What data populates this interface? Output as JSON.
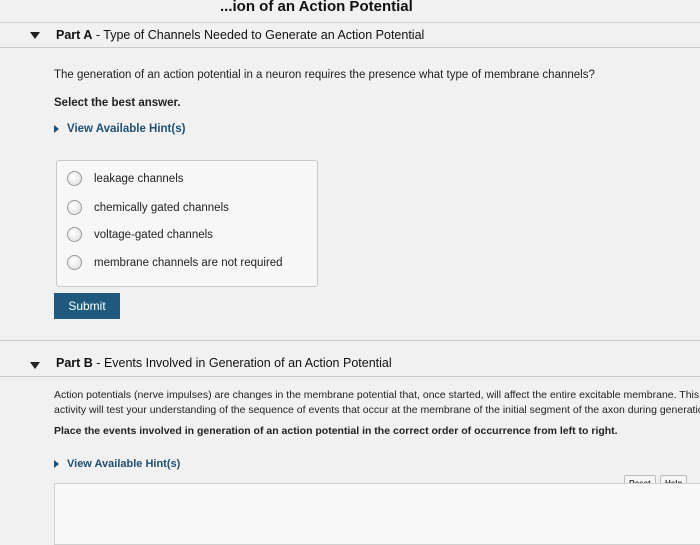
{
  "header": {
    "title": "...ion of an Action Potential"
  },
  "part_a": {
    "label": "Part A",
    "title": "Type of Channels Needed to Generate an Action Potential",
    "question": "The generation of an action potential in a neuron requires the presence what type of membrane channels?",
    "instruction": "Select the best answer.",
    "hint": "View Available Hint(s)",
    "options": [
      "leakage channels",
      "chemically gated channels",
      "voltage-gated channels",
      "membrane channels are not required"
    ],
    "submit": "Submit"
  },
  "part_b": {
    "label": "Part B",
    "title": "Events Involved in Generation of an Action Potential",
    "line1": "Action potentials (nerve impulses) are changes in the membrane potential that, once started, will affect the entire excitable membrane. This",
    "line2": "activity will test your understanding of the sequence of events that occur at the membrane of the initial segment of the axon during generation",
    "instruction": "Place the events involved in generation of an action potential in the correct order of occurrence from left to right.",
    "hint": "View Available Hint(s)",
    "reset": "Reset",
    "help": "Help"
  }
}
